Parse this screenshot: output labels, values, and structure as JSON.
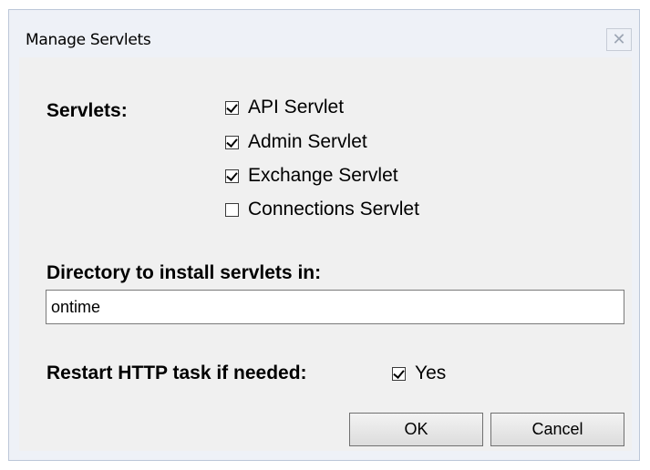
{
  "dialog": {
    "title": "Manage Servlets",
    "close_glyph": "✕"
  },
  "servlets": {
    "label": "Servlets:",
    "items": [
      {
        "label": "API Servlet",
        "checked": true
      },
      {
        "label": "Admin Servlet",
        "checked": true
      },
      {
        "label": "Exchange Servlet",
        "checked": true
      },
      {
        "label": "Connections Servlet",
        "checked": false
      }
    ]
  },
  "directory": {
    "label": "Directory to install servlets in:",
    "value": "ontime"
  },
  "restart": {
    "label": "Restart HTTP task if needed:",
    "option_label": "Yes",
    "checked": true
  },
  "buttons": {
    "ok_label": "OK",
    "cancel_label": "Cancel"
  }
}
